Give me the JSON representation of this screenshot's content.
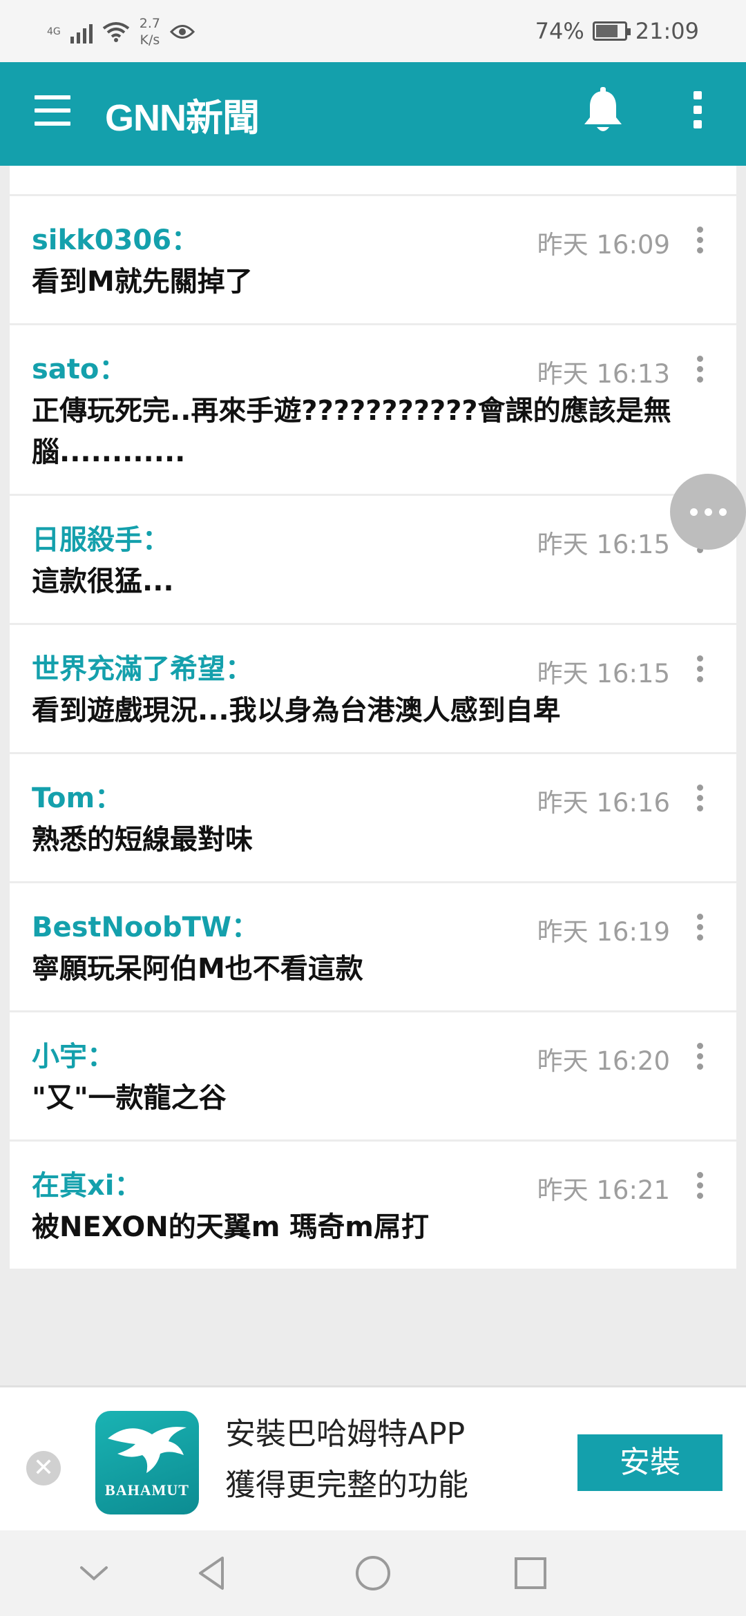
{
  "status_bar": {
    "network_type": "4G",
    "net_speed_value": "2.7",
    "net_speed_unit": "K/s",
    "battery": "74%",
    "time": "21:09"
  },
  "app_bar": {
    "title": "GNN新聞"
  },
  "comments": [
    {
      "name": "sikk0306：",
      "time": "昨天 16:09",
      "text": "看到M就先關掉了"
    },
    {
      "name": "sato：",
      "time": "昨天 16:13",
      "text": "正傳玩死完..再來手遊???????????會課的應該是無腦............"
    },
    {
      "name": "日服殺手：",
      "time": "昨天 16:15",
      "text": "這款很猛..."
    },
    {
      "name": "世界充滿了希望：",
      "time": "昨天 16:15",
      "text": "看到遊戲現況...我以身為台港澳人感到自卑"
    },
    {
      "name": "Tom：",
      "time": "昨天 16:16",
      "text": "熟悉的短線最對味"
    },
    {
      "name": "BestNoobTW：",
      "time": "昨天 16:19",
      "text": "寧願玩呆阿伯M也不看這款"
    },
    {
      "name": "小宇：",
      "time": "昨天 16:20",
      "text": "\"又\"一款龍之谷"
    },
    {
      "name": "在真xi：",
      "time": "昨天 16:21",
      "text": "被NEXON的天翼m 瑪奇m屌打"
    }
  ],
  "banner": {
    "logo_text": "BAHAMUT",
    "title": "安裝巴哈姆特APP",
    "subtitle": "獲得更完整的功能",
    "install_label": "安裝"
  },
  "colors": {
    "accent": "#14a0ac",
    "name_color": "#14a0ac",
    "time_color": "#9e9e9e"
  },
  "icons": {
    "menu": "hamburger-icon",
    "notifications": "bell-icon",
    "overflow": "more-vertical-icon",
    "fab": "more-horizontal-icon",
    "close": "close-icon",
    "nav_down": "chevron-down-icon",
    "nav_back": "back-triangle-icon",
    "nav_home": "home-circle-icon",
    "nav_recents": "recents-square-icon"
  }
}
